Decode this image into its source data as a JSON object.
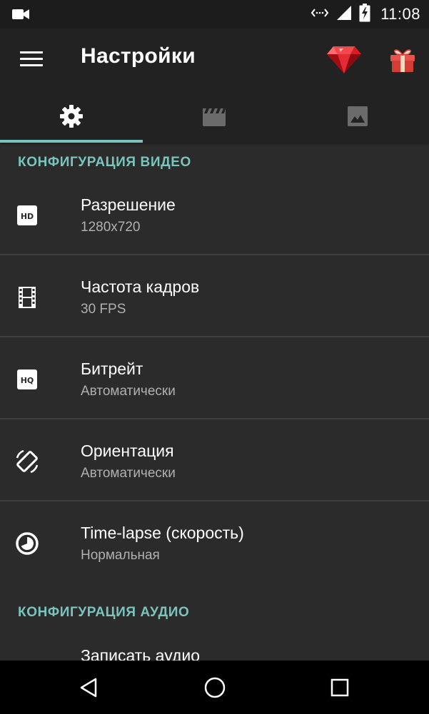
{
  "status_bar": {
    "time": "11:08",
    "icons": [
      "video-camera-icon",
      "data-transfer-icon",
      "signal-icon",
      "battery-charging-icon"
    ]
  },
  "app_bar": {
    "title": "Настройки",
    "menu_icon": "menu-icon",
    "gem_icon": "ruby-gem-icon",
    "gift_icon": "gift-icon"
  },
  "tabs": [
    {
      "icon": "gear-icon",
      "active": true
    },
    {
      "icon": "movie-clapper-icon",
      "active": false
    },
    {
      "icon": "image-icon",
      "active": false
    }
  ],
  "sections": {
    "video": {
      "header": "КОНФИГУРАЦИЯ ВИДЕО",
      "items": [
        {
          "icon": "hd-icon",
          "title": "Разрешение",
          "value": "1280x720"
        },
        {
          "icon": "film-strip-icon",
          "title": "Частота кадров",
          "value": "30 FPS"
        },
        {
          "icon": "hq-icon",
          "title": "Битрейт",
          "value": "Автоматически"
        },
        {
          "icon": "screen-rotation-icon",
          "title": "Ориентация",
          "value": "Автоматически"
        },
        {
          "icon": "timelapse-icon",
          "title": "Time-lapse (скорость)",
          "value": "Нормальная"
        }
      ]
    },
    "audio": {
      "header": "КОНФИГУРАЦИЯ АУДИО",
      "items": [
        {
          "title": "Записать аудио"
        }
      ]
    }
  },
  "nav_bar": {
    "icons": [
      "back-icon",
      "home-icon",
      "recents-icon"
    ]
  },
  "colors": {
    "accent": "#79c4bd",
    "background": "#2b2b2b",
    "app_bar": "#222222",
    "divider": "#3e3e3e",
    "secondary_text": "#b0b0b0"
  }
}
